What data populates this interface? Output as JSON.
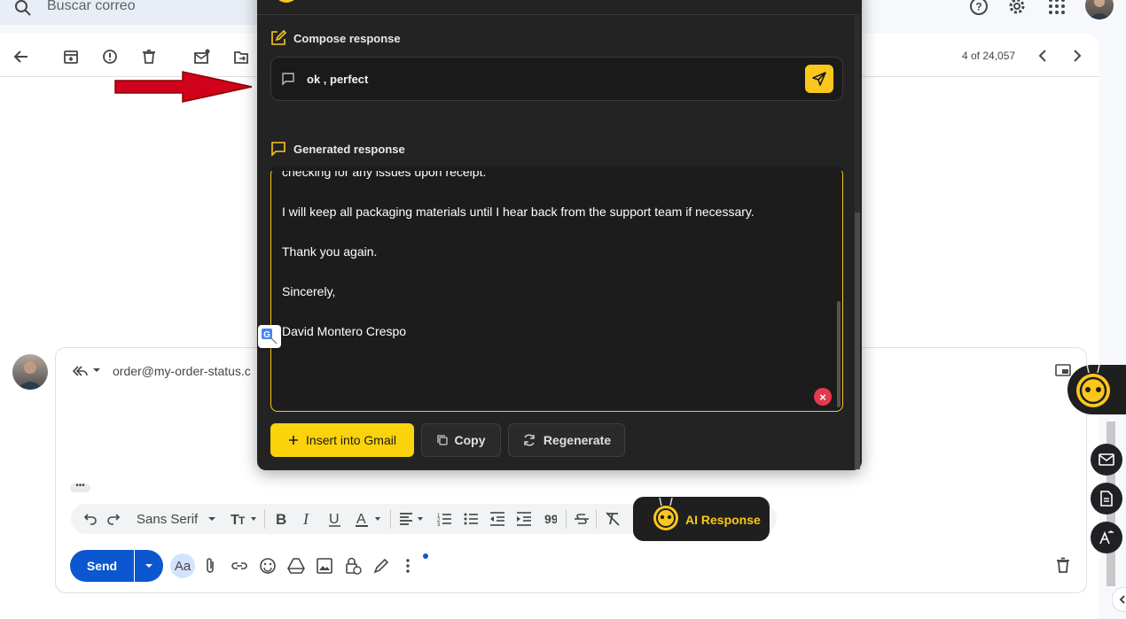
{
  "search": {
    "placeholder": "Buscar correo"
  },
  "toolbar": {
    "pager": "4 of 24,057"
  },
  "reply": {
    "recipient": "order@my-order-status.c",
    "send_label": "Send",
    "font_name": "Sans Serif",
    "text_format_label": "Aa",
    "ellipsis": "•••"
  },
  "ai_button": {
    "label": "AI Response"
  },
  "panel": {
    "compose_title": "Compose response",
    "compose_value": "ok , perfect",
    "generated_title": "Generated response",
    "generated_lines": [
      "checking for any issues upon receipt.",
      "I will keep all packaging materials until I hear back from the support team if necessary.",
      "Thank you again.",
      "Sincerely,",
      "David Montero Crespo"
    ],
    "insert_label": "Insert into Gmail",
    "copy_label": "Copy",
    "regenerate_label": "Regenerate"
  },
  "colors": {
    "accent_yellow": "#fbc71d",
    "send_blue": "#0b57d0",
    "panel_bg": "#232323",
    "arrow_red": "#d0021b"
  },
  "icons": [
    "search-icon",
    "help-icon",
    "gear-icon",
    "apps-icon",
    "back-icon",
    "archive-icon",
    "report-spam-icon",
    "delete-icon",
    "mark-unread-icon",
    "move-to-icon",
    "chevron-left-icon",
    "chevron-right-icon",
    "reply-icon",
    "popout-icon",
    "undo-icon",
    "redo-icon",
    "bold-icon",
    "italic-icon",
    "underline-icon",
    "attach-icon",
    "link-icon",
    "emoji-icon",
    "drive-icon",
    "photo-icon",
    "lock-icon",
    "pen-icon",
    "more-icon",
    "trash-icon",
    "send-icon",
    "edit-icon",
    "message-icon",
    "copy-icon",
    "refresh-icon",
    "translate-icon",
    "bot-icon"
  ]
}
